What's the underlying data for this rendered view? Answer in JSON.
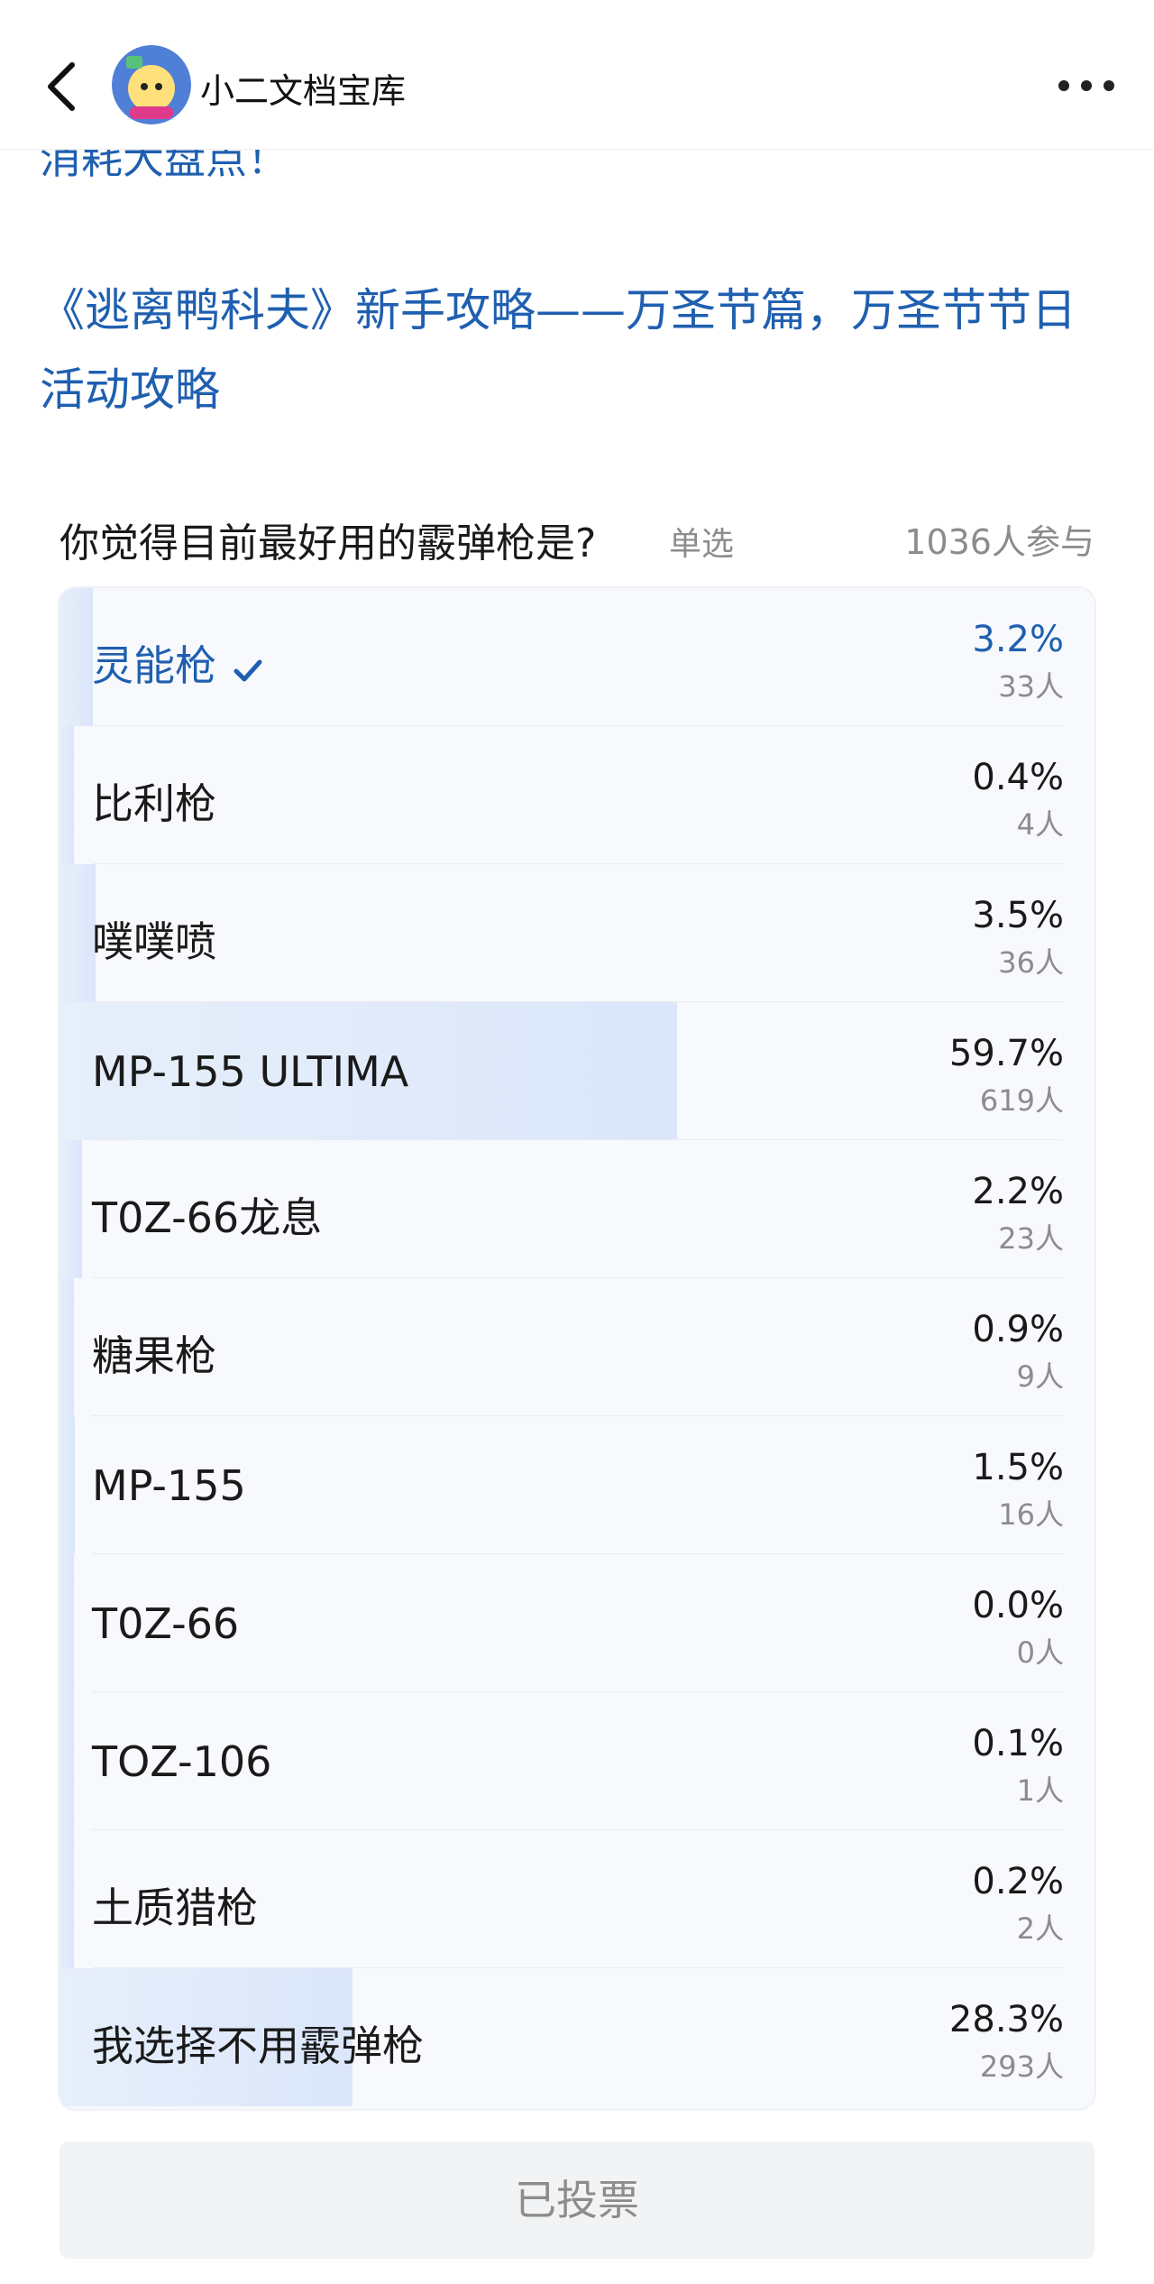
{
  "header": {
    "brand": "小二文档宝库",
    "back_icon": "chevron-left-icon",
    "more_icon": "more-dots-icon"
  },
  "article": {
    "cut_link": "消耗大盘点！",
    "link": "《逃离鸭科夫》新手攻略——万圣节篇，万圣节节日活动攻略"
  },
  "poll": {
    "question": "你觉得目前最好用的霰弹枪是?",
    "type": "单选",
    "participants": "1036人参与",
    "options": [
      {
        "label": "灵能枪",
        "percent": "3.2%",
        "count": "33人",
        "fraction": 0.032,
        "selected": true
      },
      {
        "label": "比利枪",
        "percent": "0.4%",
        "count": "4人",
        "fraction": 0.004,
        "selected": false
      },
      {
        "label": "噗噗喷",
        "percent": "3.5%",
        "count": "36人",
        "fraction": 0.035,
        "selected": false
      },
      {
        "label": "MP-155 ULTIMA",
        "percent": "59.7%",
        "count": "619人",
        "fraction": 0.597,
        "selected": false
      },
      {
        "label": "T0Z-66龙息",
        "percent": "2.2%",
        "count": "23人",
        "fraction": 0.022,
        "selected": false
      },
      {
        "label": "糖果枪",
        "percent": "0.9%",
        "count": "9人",
        "fraction": 0.009,
        "selected": false
      },
      {
        "label": "MP-155",
        "percent": "1.5%",
        "count": "16人",
        "fraction": 0.015,
        "selected": false
      },
      {
        "label": "T0Z-66",
        "percent": "0.0%",
        "count": "0人",
        "fraction": 0.0,
        "selected": false
      },
      {
        "label": "TOZ-106",
        "percent": "0.1%",
        "count": "1人",
        "fraction": 0.001,
        "selected": false
      },
      {
        "label": "土质猎枪",
        "percent": "0.2%",
        "count": "2人",
        "fraction": 0.002,
        "selected": false
      },
      {
        "label": "我选择不用霰弹枪",
        "percent": "28.3%",
        "count": "293人",
        "fraction": 0.283,
        "selected": false
      }
    ],
    "voted_label": "已投票"
  },
  "colors": {
    "link": "#1f5fb0",
    "bar_fill": "#dbe6fb",
    "muted": "#8c8c8c"
  }
}
